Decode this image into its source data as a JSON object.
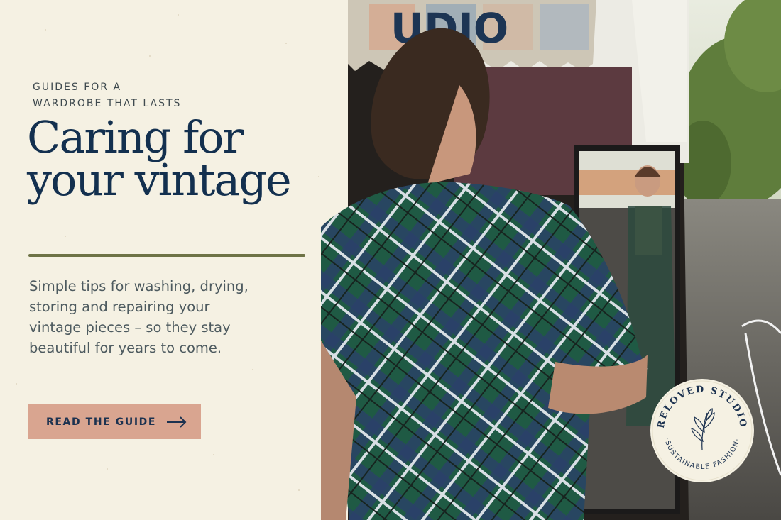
{
  "eyebrow": {
    "line1": "GUIDES FOR A",
    "line2": "WARDROBE THAT LASTS"
  },
  "headline": {
    "line1": "Caring for",
    "line2": "your vintage"
  },
  "subcopy": {
    "line1": "Simple tips for washing, drying,",
    "line2": "storing and repairing your",
    "line3": "vintage pieces – so they stay",
    "line4": "beautiful for years to come."
  },
  "cta": {
    "label": "READ THE GUIDE",
    "icon": "arrow-right-icon"
  },
  "seal": {
    "top_text": "RELOVED STUDIO",
    "bottom_text": "·SUSTAINABLE FASHION·",
    "icon": "leaf-sprig-icon"
  },
  "photo": {
    "banner_letters": "UDIO"
  },
  "colors": {
    "background": "#f5f1e3",
    "headline": "#13304f",
    "body_text": "#4d5a5f",
    "rule": "#6e7346",
    "cta_bg": "#d9a590",
    "cta_text": "#1c3250"
  }
}
